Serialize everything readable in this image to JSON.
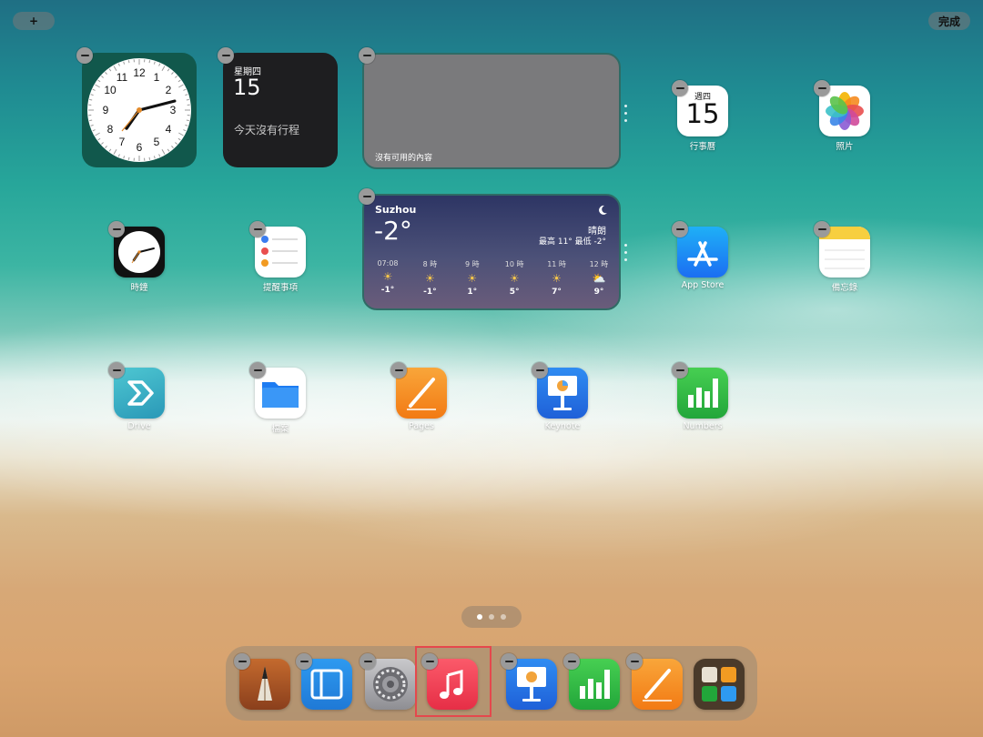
{
  "top_bar": {
    "add_button": "+",
    "done_button": "完成"
  },
  "widgets": {
    "clock": {
      "numbers": [
        "12",
        "1",
        "2",
        "3",
        "4",
        "5",
        "6",
        "7",
        "8",
        "9",
        "10",
        "11"
      ]
    },
    "calendar": {
      "weekday": "星期四",
      "day": "15",
      "no_events": "今天沒有行程"
    },
    "empty": {
      "message": "沒有可用的內容"
    },
    "weather": {
      "city": "Suzhou",
      "temp": "-2°",
      "condition": "晴朗",
      "range": "最高 11° 最低 -2°",
      "hours": [
        {
          "time": "07:08",
          "temp": "-1°"
        },
        {
          "time": "8 時",
          "temp": "-1°"
        },
        {
          "time": "9 時",
          "temp": "1°"
        },
        {
          "time": "10 時",
          "temp": "5°"
        },
        {
          "time": "11 時",
          "temp": "7°"
        },
        {
          "time": "12 時",
          "temp": "9°"
        }
      ]
    }
  },
  "apps": {
    "calendar": {
      "label": "行事曆",
      "weekday": "週四",
      "day": "15"
    },
    "photos": {
      "label": "照片"
    },
    "clock": {
      "label": "時鐘"
    },
    "reminders": {
      "label": "提醒事項"
    },
    "appstore": {
      "label": "App Store"
    },
    "notes": {
      "label": "備忘錄"
    },
    "drive": {
      "label": "Drive"
    },
    "files": {
      "label": "檔案"
    },
    "pages": {
      "label": "Pages"
    },
    "keynote": {
      "label": "Keynote"
    },
    "numbers": {
      "label": "Numbers"
    }
  },
  "colors": {
    "music_highlight": "#e5484d",
    "dock_bg": "#b9a287"
  }
}
